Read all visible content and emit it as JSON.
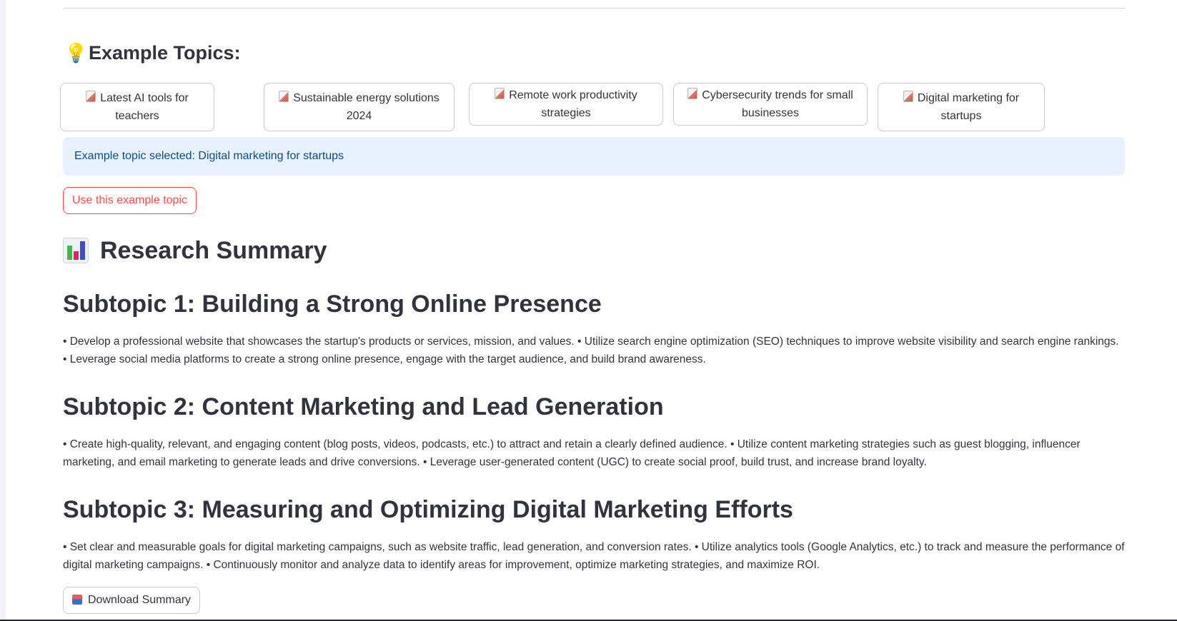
{
  "example_topics": {
    "heading": "Example Topics:",
    "heading_icon": "lightbulb-icon",
    "buttons": [
      {
        "label": "Latest AI tools for teachers",
        "icon": "memo-icon"
      },
      {
        "label": "Sustainable energy solutions 2024",
        "icon": "memo-icon"
      },
      {
        "label": "Remote work productivity strategies",
        "icon": "memo-icon"
      },
      {
        "label": "Cybersecurity trends for small businesses",
        "icon": "memo-icon"
      },
      {
        "label": "Digital marketing for startups",
        "icon": "memo-icon"
      }
    ],
    "selected_info": "Example topic selected: Digital marketing for startups",
    "use_button": "Use this example topic"
  },
  "research": {
    "heading": "Research Summary",
    "heading_icon": "bar-chart-icon",
    "subtopics": [
      {
        "title": "Subtopic 1: Building a Strong Online Presence",
        "body": "• Develop a professional website that showcases the startup's products or services, mission, and values. • Utilize search engine optimization (SEO) techniques to improve website visibility and search engine rankings. • Leverage social media platforms to create a strong online presence, engage with the target audience, and build brand awareness."
      },
      {
        "title": "Subtopic 2: Content Marketing and Lead Generation",
        "body": "• Create high-quality, relevant, and engaging content (blog posts, videos, podcasts, etc.) to attract and retain a clearly defined audience. • Utilize content marketing strategies such as guest blogging, influencer marketing, and email marketing to generate leads and drive conversions. • Leverage user-generated content (UGC) to create social proof, build trust, and increase brand loyalty."
      },
      {
        "title": "Subtopic 3: Measuring and Optimizing Digital Marketing Efforts",
        "body": "• Set clear and measurable goals for digital marketing campaigns, such as website traffic, lead generation, and conversion rates. • Utilize analytics tools (Google Analytics, etc.) to track and measure the performance of digital marketing campaigns. • Continuously monitor and analyze data to identify areas for improvement, optimize marketing strategies, and maximize ROI."
      }
    ],
    "download_button": "Download Summary",
    "download_icon": "inbox-tray-icon"
  },
  "colors": {
    "accent_red": "#ff4b4b",
    "info_bg": "#e6f1fb",
    "info_text": "#0d4b82",
    "text": "#31333f"
  }
}
